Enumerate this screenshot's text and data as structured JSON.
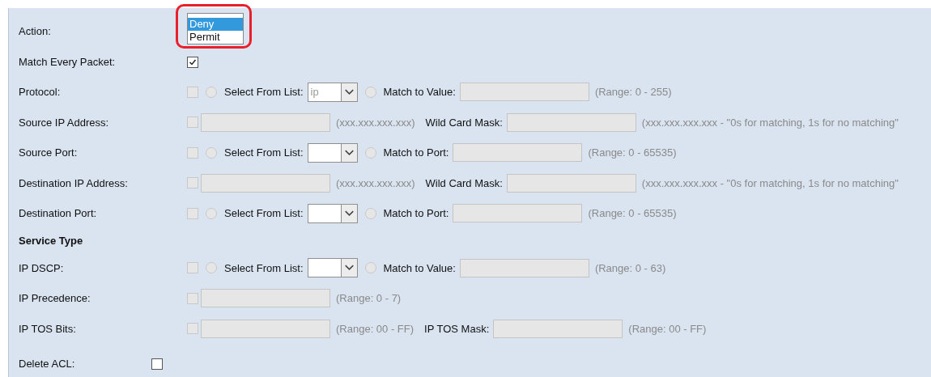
{
  "action": {
    "label": "Action:",
    "options": [
      {
        "label": "Deny",
        "selected": true
      },
      {
        "label": "Permit",
        "selected": false
      }
    ]
  },
  "match_every_packet": {
    "label": "Match Every Packet:",
    "checked": true
  },
  "rows": [
    {
      "label": "Protocol:",
      "controls": [
        {
          "kind": "checkbox",
          "checked": false,
          "disabled": true
        },
        {
          "kind": "radio",
          "selected": false
        },
        {
          "kind": "text",
          "text": "Select From List:"
        },
        {
          "kind": "select",
          "value": "ip"
        },
        {
          "kind": "radio",
          "selected": false
        },
        {
          "kind": "text",
          "text": "Match to Value:"
        },
        {
          "kind": "input"
        },
        {
          "kind": "hint",
          "text": "(Range: 0 - 255)"
        }
      ]
    },
    {
      "label": "Source IP Address:",
      "controls": [
        {
          "kind": "checkbox",
          "checked": false,
          "disabled": true
        },
        {
          "kind": "input"
        },
        {
          "kind": "hint",
          "text": "(xxx.xxx.xxx.xxx)"
        },
        {
          "kind": "text",
          "text": "Wild Card Mask:"
        },
        {
          "kind": "input"
        },
        {
          "kind": "hint",
          "text": "(xxx.xxx.xxx.xxx - \"0s for matching, 1s for no matching\""
        }
      ]
    },
    {
      "label": "Source Port:",
      "controls": [
        {
          "kind": "checkbox",
          "checked": false,
          "disabled": true
        },
        {
          "kind": "radio",
          "selected": false
        },
        {
          "kind": "text",
          "text": "Select From List:"
        },
        {
          "kind": "select"
        },
        {
          "kind": "radio",
          "selected": false
        },
        {
          "kind": "text",
          "text": "Match to Port:"
        },
        {
          "kind": "input"
        },
        {
          "kind": "hint",
          "text": "(Range: 0 - 65535)"
        }
      ]
    },
    {
      "label": "Destination IP Address:",
      "controls": [
        {
          "kind": "checkbox",
          "checked": false,
          "disabled": true
        },
        {
          "kind": "input"
        },
        {
          "kind": "hint",
          "text": "(xxx.xxx.xxx.xxx)"
        },
        {
          "kind": "text",
          "text": "Wild Card Mask:"
        },
        {
          "kind": "input"
        },
        {
          "kind": "hint",
          "text": "(xxx.xxx.xxx.xxx - \"0s for matching, 1s for no matching\""
        }
      ]
    },
    {
      "label": "Destination Port:",
      "controls": [
        {
          "kind": "checkbox",
          "checked": false,
          "disabled": true
        },
        {
          "kind": "radio",
          "selected": false
        },
        {
          "kind": "text",
          "text": "Select From List:"
        },
        {
          "kind": "select"
        },
        {
          "kind": "radio",
          "selected": false
        },
        {
          "kind": "text",
          "text": "Match to Port:"
        },
        {
          "kind": "input"
        },
        {
          "kind": "hint",
          "text": "(Range: 0 - 65535)"
        }
      ]
    },
    {
      "heading": "Service Type"
    },
    {
      "label": "IP DSCP:",
      "controls": [
        {
          "kind": "checkbox",
          "checked": false,
          "disabled": true
        },
        {
          "kind": "radio",
          "selected": false
        },
        {
          "kind": "text",
          "text": "Select From List:"
        },
        {
          "kind": "select"
        },
        {
          "kind": "radio",
          "selected": false
        },
        {
          "kind": "text",
          "text": "Match to Value:"
        },
        {
          "kind": "input"
        },
        {
          "kind": "hint",
          "text": "(Range: 0 - 63)"
        }
      ]
    },
    {
      "label": "IP Precedence:",
      "controls": [
        {
          "kind": "checkbox",
          "checked": false,
          "disabled": true
        },
        {
          "kind": "input"
        },
        {
          "kind": "hint",
          "text": "(Range: 0 - 7)"
        }
      ]
    },
    {
      "label": "IP TOS Bits:",
      "controls": [
        {
          "kind": "checkbox",
          "checked": false,
          "disabled": true
        },
        {
          "kind": "input"
        },
        {
          "kind": "hint",
          "text": "(Range: 00 - FF)"
        },
        {
          "kind": "text",
          "text": "IP TOS Mask:"
        },
        {
          "kind": "input"
        },
        {
          "kind": "hint",
          "text": "(Range: 00 - FF)"
        }
      ]
    }
  ],
  "delete_acl": {
    "label": "Delete ACL:",
    "checked": false
  }
}
